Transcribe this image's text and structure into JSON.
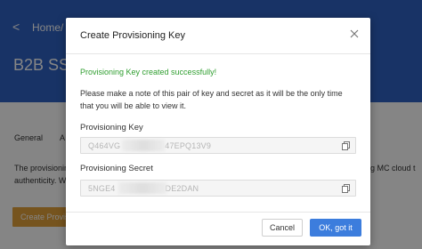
{
  "background": {
    "breadcrumb": {
      "back_glyph": "<",
      "home": "Home",
      "separator": "/"
    },
    "page_title": "B2B SSC",
    "tabs": [
      "General",
      "A"
    ],
    "description_line1_left": "The provisionin",
    "description_line1_right": "ng MC cloud t",
    "description_line2": "authenticity. W",
    "create_button_label": "Create Provis",
    "colors": {
      "header": "#2f63c4",
      "create_button": "#e2a13a"
    }
  },
  "modal": {
    "title": "Create Provisioning Key",
    "success_message": "Provisioning Key created successfully!",
    "note_line1": "Please make a note of this pair of key and secret as it will be the only time",
    "note_line2": "that you will be able to view it.",
    "key_field": {
      "label": "Provisioning Key",
      "value_start": "Q464VG",
      "value_end": "47EPQ13V9",
      "icon": "copy-icon"
    },
    "secret_field": {
      "label": "Provisioning Secret",
      "value_start": "5NGE4",
      "value_end": "DE2DAN",
      "icon": "copy-icon"
    },
    "cancel_label": "Cancel",
    "ok_label": "OK, got it",
    "colors": {
      "success": "#2f9e2f",
      "primary": "#3c7ddd"
    }
  }
}
